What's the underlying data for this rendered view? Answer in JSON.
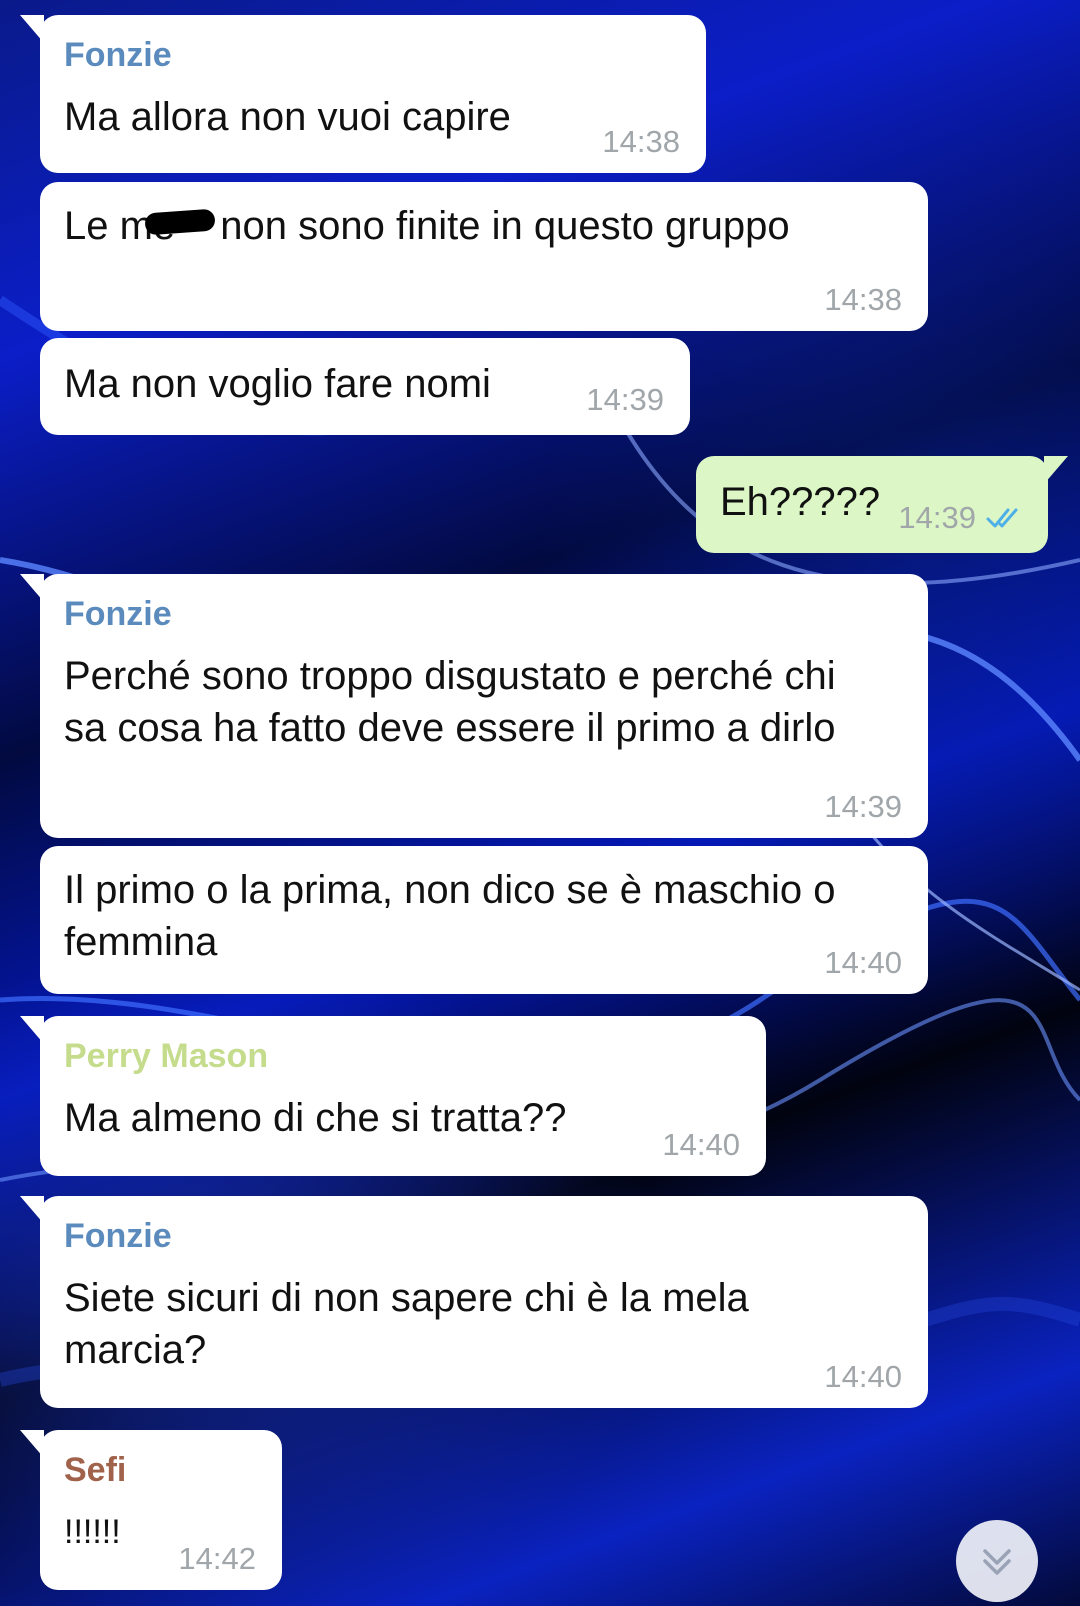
{
  "messages": [
    {
      "sender": "Fonzie",
      "sender_color": "#5b8bbd",
      "text": "Ma allora non vuoi capire",
      "time": "14:38"
    },
    {
      "text_before": "Le me",
      "text_after": " non sono finite in questo gruppo",
      "time": "14:38"
    },
    {
      "text": "Ma non voglio fare nomi",
      "time": "14:39"
    },
    {
      "text": "Eh?????",
      "time": "14:39",
      "outgoing": true,
      "status_icon": "double-check-icon"
    },
    {
      "sender": "Fonzie",
      "sender_color": "#5b8bbd",
      "text": "Perché sono troppo disgustato e perché chi sa cosa ha fatto deve essere il primo a dirlo",
      "time": "14:39"
    },
    {
      "text": "Il primo o la prima, non dico se è maschio o femmina",
      "time": "14:40"
    },
    {
      "sender": "Perry Mason",
      "sender_color": "#c4dc8b",
      "text": "Ma almeno di che si tratta??",
      "time": "14:40"
    },
    {
      "sender": "Fonzie",
      "sender_color": "#5b8bbd",
      "text": "Siete sicuri di non sapere chi è la mela marcia?",
      "time": "14:40"
    },
    {
      "sender": "Sefi",
      "sender_color": "#a0624a",
      "text": "!!!!!!",
      "time": "14:42"
    }
  ],
  "scroll_button": {
    "icon": "double-chevron-down-icon"
  },
  "colors": {
    "incoming_bubble": "#ffffff",
    "outgoing_bubble": "#dcf7c5",
    "timestamp": "#a0a6a9",
    "read_checks": "#4fb0e8"
  }
}
